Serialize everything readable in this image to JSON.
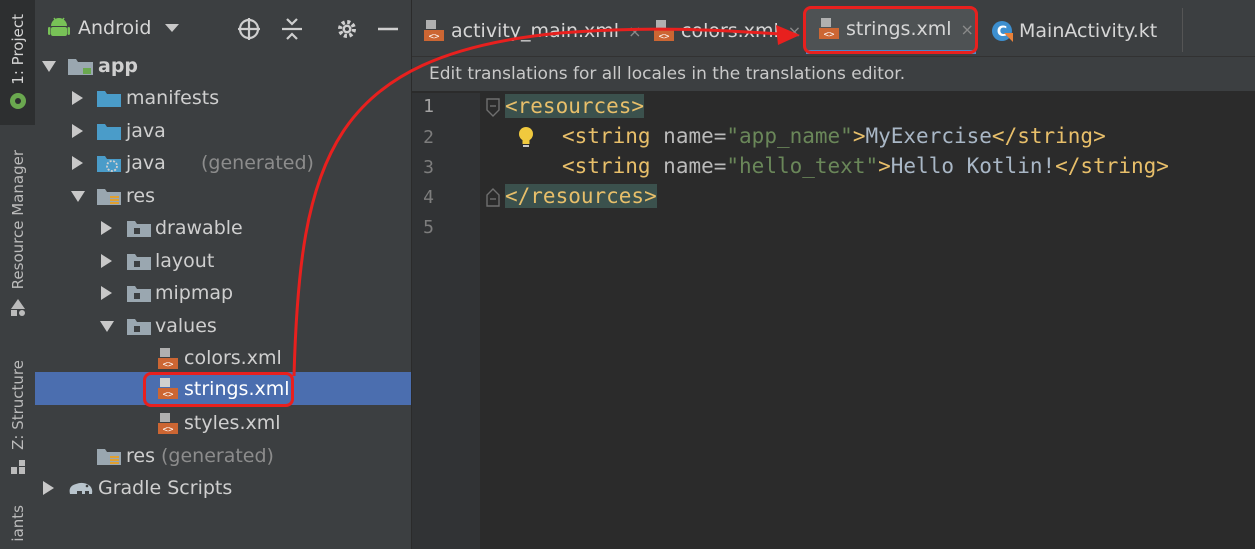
{
  "side_strip": {
    "project_tab": "1: Project",
    "resource_manager_tab": "Resource Manager",
    "structure_tab": "Z: Structure",
    "variants_tab": "iants"
  },
  "project_panel": {
    "view_mode": "Android",
    "tree": [
      {
        "label": "app",
        "suffix": ""
      },
      {
        "label": "manifests",
        "suffix": ""
      },
      {
        "label": "java",
        "suffix": ""
      },
      {
        "label": "java",
        "suffix": "(generated)"
      },
      {
        "label": "res",
        "suffix": ""
      },
      {
        "label": "drawable",
        "suffix": ""
      },
      {
        "label": "layout",
        "suffix": ""
      },
      {
        "label": "mipmap",
        "suffix": ""
      },
      {
        "label": "values",
        "suffix": ""
      },
      {
        "label": "colors.xml",
        "suffix": ""
      },
      {
        "label": "strings.xml",
        "suffix": ""
      },
      {
        "label": "styles.xml",
        "suffix": ""
      },
      {
        "label": "res",
        "suffix": "(generated)"
      },
      {
        "label": "Gradle Scripts",
        "suffix": ""
      }
    ]
  },
  "editor": {
    "tabs": [
      {
        "label": "activity_main.xml"
      },
      {
        "label": "colors.xml"
      },
      {
        "label": "strings.xml"
      },
      {
        "label": "MainActivity.kt"
      }
    ],
    "close_glyph": "×",
    "notice": "Edit translations for all locales in the translations editor.",
    "line_numbers": [
      "1",
      "2",
      "3",
      "4",
      "5"
    ],
    "code": {
      "l1_open": "<resources>",
      "l2_open": "<string",
      "l2_attr": "name=",
      "l2_val": "\"app_name\"",
      "l2_gt": ">",
      "l2_text": "MyExercise",
      "l2_close": "</string>",
      "l3_open": "<string",
      "l3_attr": "name=",
      "l3_val": "\"hello_text\"",
      "l3_gt": ">",
      "l3_text": "Hello Kotlin!",
      "l3_close": "</string>",
      "l4_close": "</resources>"
    }
  },
  "colors": {
    "selection": "#4b6eaf",
    "annotation": "#e8201e",
    "tag": "#e8bf6a",
    "string_value": "#6a8759",
    "active_tab_underline": "#4a88c7"
  }
}
